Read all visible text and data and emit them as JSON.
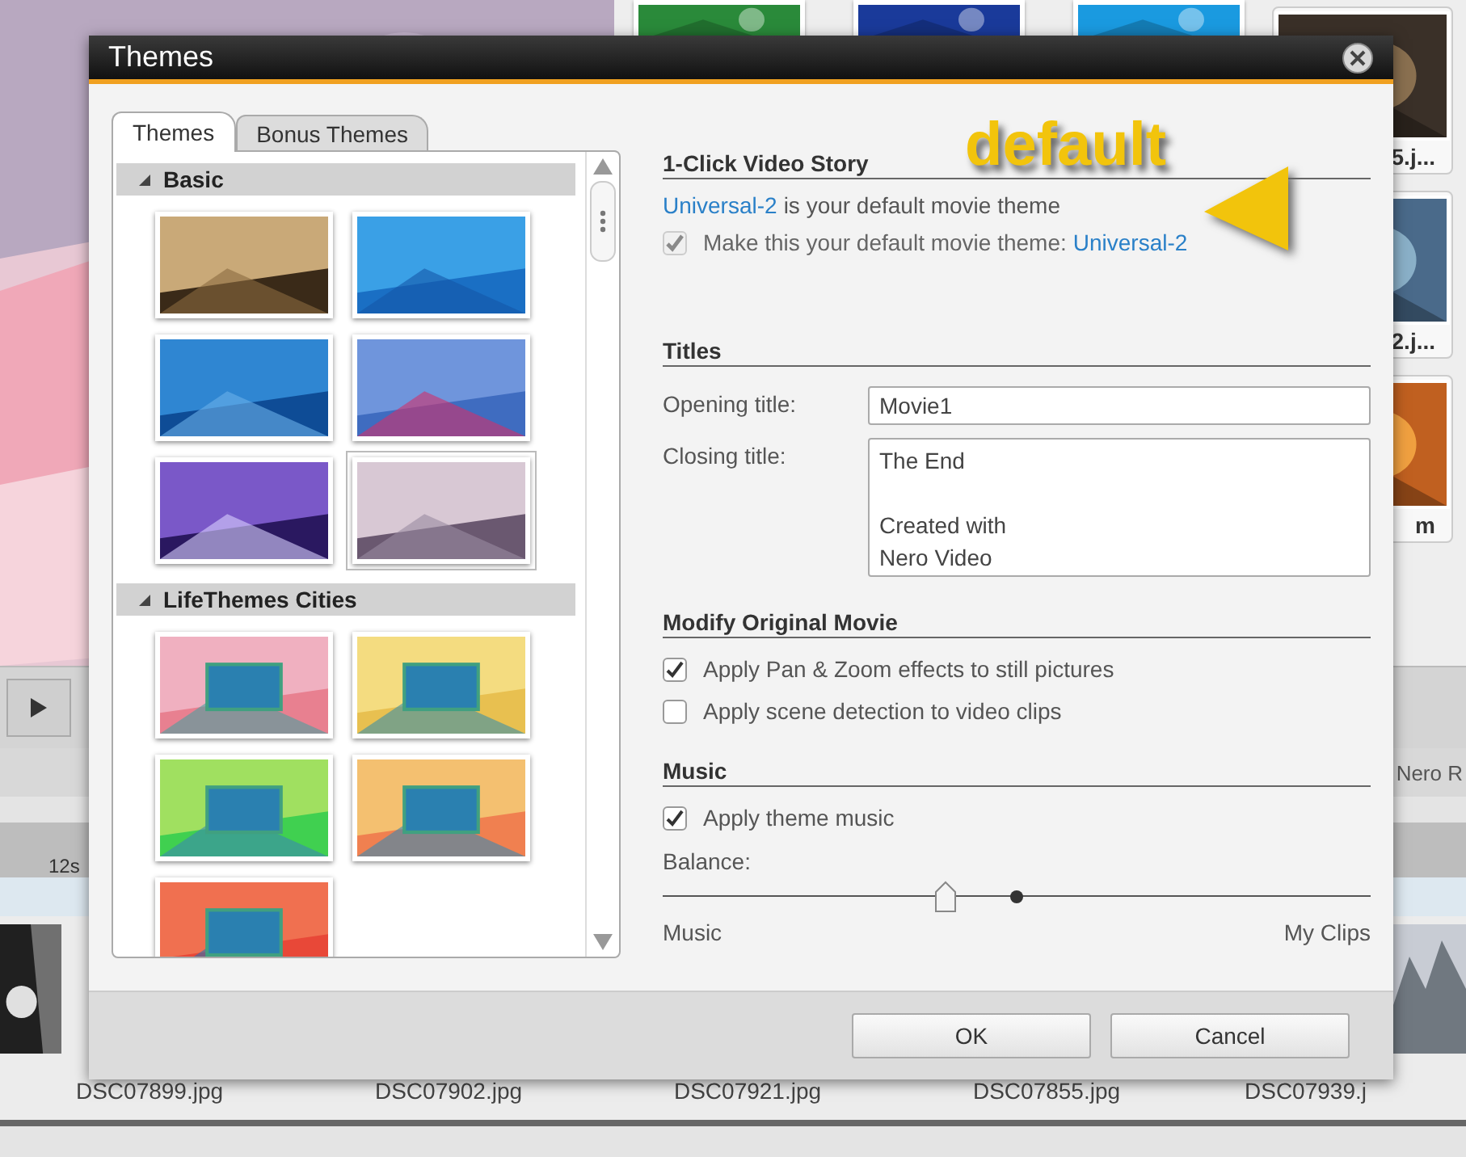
{
  "background": {
    "card_labels": [
      "5.j...",
      "2.j...",
      "m"
    ],
    "tab_label": "Nero R",
    "timeline_mark": "12s",
    "file_labels": [
      "DSC07899.jpg",
      "DSC07902.jpg",
      "DSC07921.jpg",
      "DSC07855.jpg",
      "DSC07939.j"
    ]
  },
  "dialog": {
    "title": "Themes",
    "tabs": [
      {
        "label": "Themes",
        "selected": true
      },
      {
        "label": "Bonus Themes",
        "selected": false
      }
    ],
    "groups": [
      {
        "name": "Basic",
        "expanded": true,
        "themes": [
          {
            "kind": "picture",
            "selected": false
          },
          {
            "kind": "picture",
            "selected": false
          },
          {
            "kind": "picture",
            "selected": false
          },
          {
            "kind": "picture",
            "selected": false
          },
          {
            "kind": "picture",
            "selected": false
          },
          {
            "kind": "picture",
            "selected": true
          }
        ]
      },
      {
        "name": "LifeThemes Cities",
        "expanded": true,
        "themes": [
          {
            "kind": "picture",
            "selected": false
          },
          {
            "kind": "picture",
            "selected": false
          },
          {
            "kind": "picture",
            "selected": false
          },
          {
            "kind": "picture",
            "selected": false
          },
          {
            "kind": "picture",
            "selected": false
          }
        ]
      }
    ],
    "story": {
      "heading": "1-Click Video Story",
      "theme_name": "Universal-2",
      "status_text": "is your default movie theme",
      "default_option": {
        "label": "Make this your default movie theme:",
        "theme_name": "Universal-2",
        "checked": true,
        "disabled": true
      }
    },
    "titles": {
      "heading": "Titles",
      "opening_label": "Opening title:",
      "opening_value": "Movie1",
      "closing_label": "Closing title:",
      "closing_value": "The End\n\nCreated with\nNero Video"
    },
    "modify": {
      "heading": "Modify Original Movie",
      "options": [
        {
          "label": "Apply Pan & Zoom effects to still pictures",
          "checked": true
        },
        {
          "label": "Apply scene detection to video clips",
          "checked": false
        }
      ]
    },
    "music": {
      "heading": "Music",
      "options": [
        {
          "label": "Apply theme music",
          "checked": true
        }
      ],
      "balance_label": "Balance:",
      "level": 0.4,
      "left_label": "Music",
      "right_label": "My Clips"
    },
    "buttons": [
      {
        "label": "OK"
      },
      {
        "label": "Cancel"
      }
    ],
    "annotation": {
      "text": "default"
    }
  }
}
